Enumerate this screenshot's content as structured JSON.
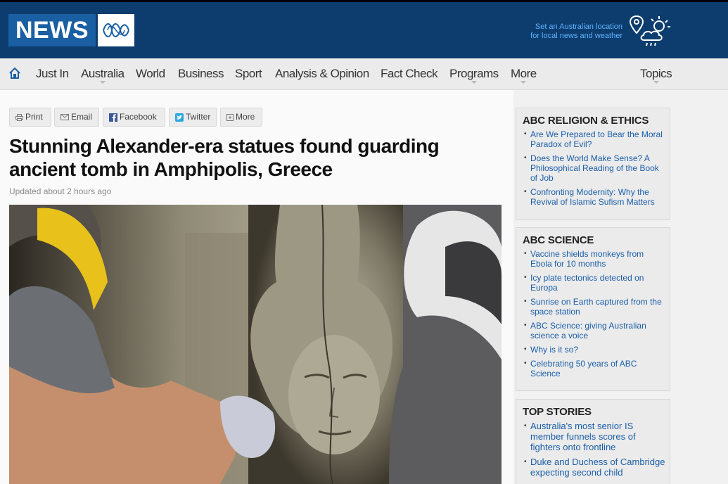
{
  "header": {
    "logo_text": "NEWS",
    "logo_abc": "ABC",
    "location_line1": "Set an Australian location",
    "location_line2": "for local news and weather",
    "weather_icon": "location-weather-icon"
  },
  "nav": {
    "home_icon": "home-icon",
    "items": [
      {
        "label": "Just In"
      },
      {
        "label": "Australia"
      },
      {
        "label": "World"
      },
      {
        "label": "Business"
      },
      {
        "label": "Sport"
      },
      {
        "label": "Analysis & Opinion"
      },
      {
        "label": "Fact Check"
      },
      {
        "label": "Programs"
      },
      {
        "label": "More"
      },
      {
        "label": "Topics"
      }
    ]
  },
  "share": {
    "print": "Print",
    "email": "Email",
    "facebook": "Facebook",
    "twitter": "Twitter",
    "more": "More"
  },
  "article": {
    "headline": "Stunning Alexander-era statues found guarding ancient tomb in Amphipolis, Greece",
    "updated": "Updated about 2 hours ago"
  },
  "sidebar": {
    "religion": {
      "title": "ABC RELIGION & ETHICS",
      "items": [
        "Are We Prepared to Bear the Moral Paradox of Evil?",
        "Does the World Make Sense? A Philosophical Reading of the Book of Job",
        "Confronting Modernity: Why the Revival of Islamic Sufism Matters"
      ]
    },
    "science": {
      "title": "ABC SCIENCE",
      "items": [
        "Vaccine shields monkeys from Ebola for 10 months",
        "Icy plate tectonics detected on Europa",
        "Sunrise on Earth captured from the space station",
        "ABC Science: giving Australian science a voice",
        "Why is it so?",
        "Celebrating 50 years of ABC Science"
      ]
    },
    "top_stories": {
      "title": "TOP STORIES",
      "items": [
        "Australia's most senior IS member funnels scores of fighters onto frontline",
        "Duke and Duchess of Cambridge expecting second child"
      ]
    }
  },
  "colors": {
    "header_bg": "#0d3d6e",
    "logo_blue": "#1b5fa3",
    "link_blue": "#1a5ea8",
    "location_text": "#5fb2ff"
  }
}
